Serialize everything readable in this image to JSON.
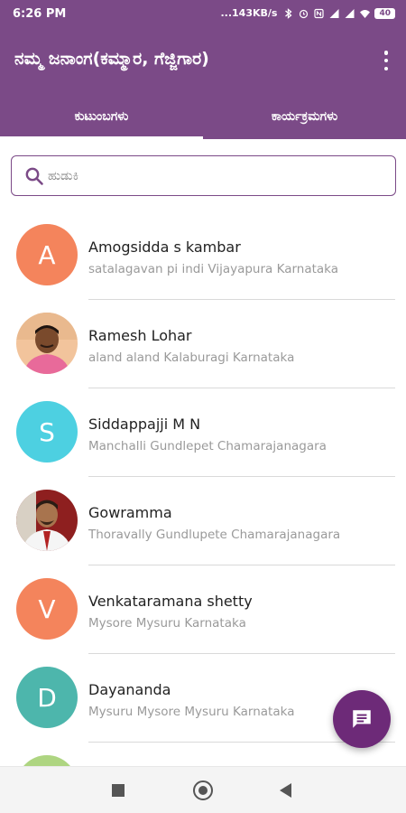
{
  "status_bar": {
    "time": "6:26 PM",
    "network_speed": "...143KB/s",
    "battery": "40",
    "icons": [
      "bluetooth-icon",
      "alarm-icon",
      "nfc-icon",
      "signal-icon",
      "signal-icon",
      "wifi-icon",
      "battery-icon"
    ]
  },
  "app_bar": {
    "title": "ನಮ್ಮ ಜನಾಂಗ(ಕಮ್ಮಾರ, ಗೆಜ್ಜಿಗಾರ)",
    "menu_icon": "more-vert-icon"
  },
  "tabs": [
    {
      "label": "ಕುಟುಂಬಗಳು",
      "active": true
    },
    {
      "label": "ಕಾರ್ಯಕ್ರಮಗಳು",
      "active": false
    }
  ],
  "search": {
    "placeholder": "ಹುಡುಕಿ",
    "value": ""
  },
  "contacts": [
    {
      "name": "Amogsidda s kambar",
      "location": "satalagavan pi indi Vijayapura Karnataka",
      "initial": "A",
      "avatar_color": "#f4845c",
      "avatar_type": "initial"
    },
    {
      "name": "Ramesh Lohar",
      "location": "aland aland Kalaburagi Karnataka",
      "initial": "",
      "avatar_color": "#f4cba4",
      "avatar_type": "photo"
    },
    {
      "name": "Siddappajji M N",
      "location": "Manchalli Gundlepet Chamarajanagara",
      "initial": "S",
      "avatar_color": "#4dd0e1",
      "avatar_type": "initial"
    },
    {
      "name": "Gowramma",
      "location": "Thoravally Gundlupete Chamarajanagara",
      "initial": "",
      "avatar_color": "#a83232",
      "avatar_type": "photo"
    },
    {
      "name": "Venkataramana shetty",
      "location": "Mysore  Mysuru Karnataka",
      "initial": "V",
      "avatar_color": "#f4845c",
      "avatar_type": "initial"
    },
    {
      "name": "Dayananda",
      "location": "Mysuru Mysore Mysuru Karnataka",
      "initial": "D",
      "avatar_color": "#4db6ac",
      "avatar_type": "initial"
    }
  ],
  "partial_avatar_color": "#aed581",
  "fab": {
    "icon": "chat-icon",
    "color": "#6d2a78"
  },
  "nav_bar": {
    "icons": [
      "recent-apps-icon",
      "home-icon",
      "back-icon"
    ]
  },
  "colors": {
    "primary": "#7b4a87",
    "accent": "#6d2a78"
  }
}
